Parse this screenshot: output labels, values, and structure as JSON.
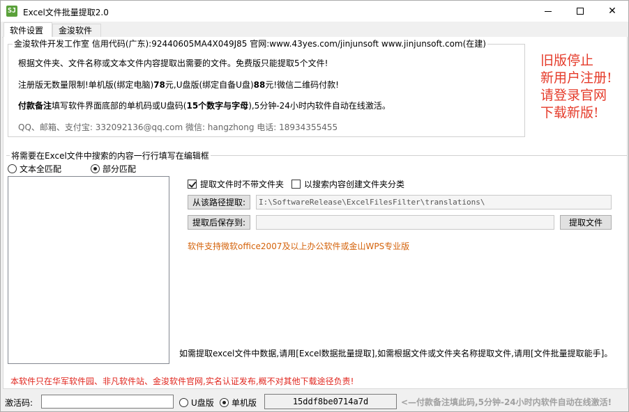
{
  "window": {
    "title": "Excel文件批量提取2.0",
    "icon_glyph": "SJ",
    "icon_name": "app-logo-icon",
    "minimize": "minimize-icon",
    "maximize": "maximize-icon",
    "close": "✕"
  },
  "tabs": [
    {
      "label": "软件设置",
      "active": true
    },
    {
      "label": "金浚软件",
      "active": false
    }
  ],
  "info": {
    "legend": "金浚软件开发工作室 信用代码(广东):92440605MA4X049J85 官网:www.43yes.com/jinjunsoft  www.jinjunsoft.com(在建)",
    "line1": "根据文件夹、文件名称或文本文件内容提取出需要的文件。免费版只能提取5个文件!",
    "line2_a": "注册版无数量限制!单机版(绑定电脑)",
    "line2_price1": "78",
    "line2_b": "元,U盘版(绑定自备U盘)",
    "line2_price2": "88",
    "line2_c": "元!微信二维码付款!",
    "line3_bold": "付款备注",
    "line3_a": "填写软件界面底部的单机码或U盘码(",
    "line3_bold2": "15个数字与字母",
    "line3_b": "),5分钟-24小时内软件自动在线激活。",
    "contact": "QQ、邮箱、支付宝: 332092136@qq.com   微信: hangzhong   电话: 18934355455"
  },
  "promo": {
    "line1": "旧版停止",
    "line2": "新用户注册!",
    "line3": "请登录官网",
    "line4": "下载新版!",
    "color": "#e53b2a"
  },
  "search": {
    "legend": "将需要在Excel文件中搜索的内容一行行填写在编辑框",
    "radio_full": "文本全匹配",
    "radio_partial": "部分匹配",
    "selected": "部分匹配"
  },
  "options": {
    "no_folder": "提取文件时不带文件夹",
    "no_folder_checked": true,
    "create_folder": "以搜索内容创建文件夹分类",
    "create_folder_checked": false
  },
  "paths": {
    "from_label": "从该路径提取:",
    "from_value": "I:\\SoftwareRelease\\ExcelFilesFilter\\translations\\",
    "save_label": "提取后保存到:",
    "save_value": "",
    "extract_button": "提取文件"
  },
  "support_text": "软件支持微软office2007及以上办公软件或金山WPS专业版",
  "hint_text": "如需提取excel文件中数据,请用[Excel数据批量提取],如需根据文件或文件夹名称提取文件,请用[文件批量提取能手]。",
  "warning_text": "本软件只在华军软件园、非凡软件站、金浚软件官网,实名认证发布,概不对其他下载途径负责!",
  "status": {
    "activation_label": "激活码:",
    "activation_value": "",
    "radio_usb": "U盘版",
    "radio_pc": "单机版",
    "selected": "单机版",
    "machine_code": "15ddf8be0714a7d",
    "tail": "<—付款备注填此码,5分钟-24小时内软件自动在线激活!"
  }
}
